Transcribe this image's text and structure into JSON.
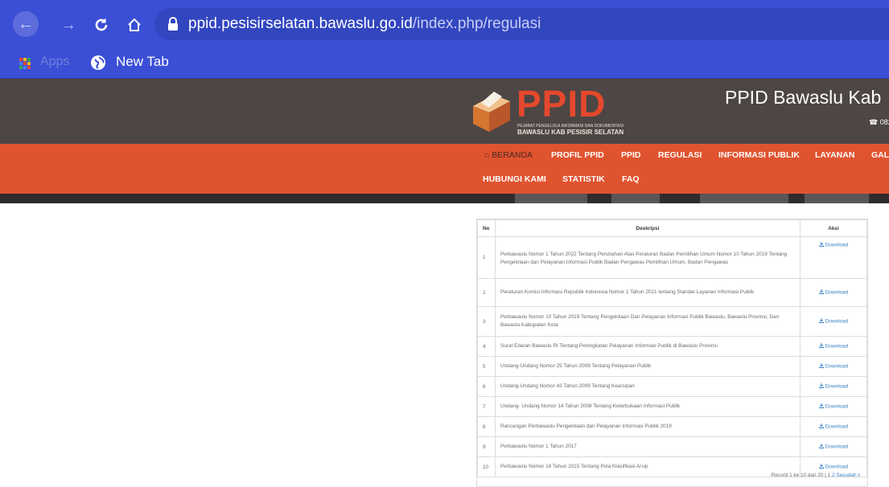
{
  "browser": {
    "url_host": "ppid.pesisirselatan.bawaslu.go.id",
    "url_path": "/index.php/regulasi",
    "bookmarks": [
      {
        "label": "Apps"
      },
      {
        "label": "New Tab"
      }
    ]
  },
  "site": {
    "logo_text": "PPID",
    "logo_sub1": "PEJABAT PENGELOLA INFORMASI DAN DOKUMENTASI",
    "logo_sub2": "BAWASLU KAB PESISIR SELATAN",
    "title": "PPID Bawaslu Kab",
    "phone": "082"
  },
  "nav": {
    "items": [
      {
        "label": "BERANDA"
      },
      {
        "label": "PROFIL PPID"
      },
      {
        "label": "PPID"
      },
      {
        "label": "REGULASI"
      },
      {
        "label": "INFORMASI PUBLIK"
      },
      {
        "label": "LAYANAN"
      },
      {
        "label": "GAL"
      },
      {
        "label": "HUBUNGI KAMI"
      },
      {
        "label": "STATISTIK"
      },
      {
        "label": "FAQ"
      }
    ]
  },
  "table": {
    "headers": {
      "no": "No",
      "desc": "Deskripsi",
      "action": "Aksi"
    },
    "download_label": "Download",
    "rows": [
      {
        "no": "1",
        "desc": "Perbawaslu Nomor 1 Tahun 2022 Tentang Perubahan Atas Peraturan Badan Pemilihan Umum Nomor 10 Tahun 2019 Tentang Pengelolaan dan Pelayanan Informasi Publik Badan Pengawas Pemilihan Umum, Badan Pengawas"
      },
      {
        "no": "2",
        "desc": "Peraturan Komisi Informasi Republik Indonesia Nomor 1 Tahun 2021 tentang Standar Layanan Informasi Publik"
      },
      {
        "no": "3",
        "desc": "Perbawaslu Nomor 10 Tahun 2019 Tentang Pengelolaan Dan Pelayanan Informasi Publik Bawaslu, Bawaslu Provinsi, Dan Bawaslu Kabupaten Kota"
      },
      {
        "no": "4",
        "desc": "Surat Edaran Bawaslu RI Tentang Peningkatan Pelayanan Informasi Publik di Bawaslu Provinsi"
      },
      {
        "no": "5",
        "desc": "Undang-Undang Nomor 25 Tahun 2009 Tentang Pelayanan Publik"
      },
      {
        "no": "6",
        "desc": "Undang-Undang Nomor 43 Tahun 2009 Tentang Kearsipan"
      },
      {
        "no": "7",
        "desc": "Undang- Undang Nomor 14 Tahun 2008 Tentang Keterbukaan Informasi Publik"
      },
      {
        "no": "8",
        "desc": "Rancangan Perbawaslu Pengelolaan dan Pelayanan Informasi Publik 2019"
      },
      {
        "no": "9",
        "desc": "Perbawaslu Nomor 1 Tahun 2017"
      },
      {
        "no": "10",
        "desc": "Perbawaslu Nomor 16 Tahun 2015 Tentang Pola Klasifikasi Arsip"
      }
    ],
    "pager": {
      "record_text": "Record 1 ke 10 dari 20 |",
      "page_1": "1",
      "page_2": "2",
      "next_label": "Sesudah"
    }
  },
  "colors": {
    "chrome": "#3b4ed6",
    "header_bg": "#4d4644",
    "nav_bg": "#e0532f",
    "logo_red": "#e5482d",
    "link": "#3a82c4"
  }
}
